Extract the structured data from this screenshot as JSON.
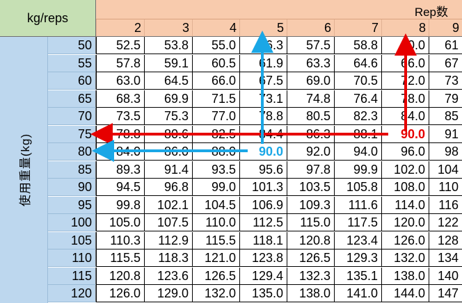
{
  "corner_label": "kg/reps",
  "header_title": "Rep数",
  "side_label": "使用重量(kg)",
  "columns": [
    "2",
    "3",
    "4",
    "5",
    "6",
    "7",
    "8",
    "9"
  ],
  "rows": [
    {
      "weight": "50",
      "values": [
        "52.5",
        "53.8",
        "55.0",
        "56.3",
        "57.5",
        "58.8",
        "60.0",
        "61"
      ]
    },
    {
      "weight": "55",
      "values": [
        "57.8",
        "59.1",
        "60.5",
        "61.9",
        "63.3",
        "64.6",
        "66.0",
        "67"
      ]
    },
    {
      "weight": "60",
      "values": [
        "63.0",
        "64.5",
        "66.0",
        "67.5",
        "69.0",
        "70.5",
        "72.0",
        "73"
      ]
    },
    {
      "weight": "65",
      "values": [
        "68.3",
        "69.9",
        "71.5",
        "73.1",
        "74.8",
        "76.4",
        "78.0",
        "79"
      ]
    },
    {
      "weight": "70",
      "values": [
        "73.5",
        "75.3",
        "77.0",
        "78.8",
        "80.5",
        "82.3",
        "84.0",
        "85"
      ]
    },
    {
      "weight": "75",
      "values": [
        "78.8",
        "80.6",
        "82.5",
        "84.4",
        "86.3",
        "88.1",
        "90.0",
        "91"
      ]
    },
    {
      "weight": "80",
      "values": [
        "84.0",
        "86.0",
        "88.0",
        "90.0",
        "92.0",
        "94.0",
        "96.0",
        "98"
      ]
    },
    {
      "weight": "85",
      "values": [
        "89.3",
        "91.4",
        "93.5",
        "95.6",
        "97.8",
        "99.9",
        "102.0",
        "104"
      ]
    },
    {
      "weight": "90",
      "values": [
        "94.5",
        "96.8",
        "99.0",
        "101.3",
        "103.5",
        "105.8",
        "108.0",
        "110"
      ]
    },
    {
      "weight": "95",
      "values": [
        "99.8",
        "102.1",
        "104.5",
        "106.9",
        "109.3",
        "111.6",
        "114.0",
        "116"
      ]
    },
    {
      "weight": "100",
      "values": [
        "105.0",
        "107.5",
        "110.0",
        "112.5",
        "115.0",
        "117.5",
        "120.0",
        "122"
      ]
    },
    {
      "weight": "105",
      "values": [
        "110.3",
        "112.9",
        "115.5",
        "118.1",
        "120.8",
        "123.4",
        "126.0",
        "128"
      ]
    },
    {
      "weight": "110",
      "values": [
        "115.5",
        "118.3",
        "121.0",
        "123.8",
        "126.5",
        "129.3",
        "132.0",
        "134"
      ]
    },
    {
      "weight": "115",
      "values": [
        "120.8",
        "123.6",
        "126.5",
        "129.4",
        "132.3",
        "135.1",
        "138.0",
        "140"
      ]
    },
    {
      "weight": "120",
      "values": [
        "126.0",
        "129.0",
        "132.0",
        "135.0",
        "138.0",
        "141.0",
        "144.0",
        "147"
      ]
    }
  ],
  "highlights": [
    {
      "row": 5,
      "col": 6,
      "color": "#e60000",
      "direction": "up-and-left"
    },
    {
      "row": 6,
      "col": 3,
      "color": "#1aa7e6",
      "direction": "up-and-left"
    }
  ],
  "colors": {
    "corner_bg": "#c6e0b4",
    "header_bg": "#f8cbad",
    "side_bg": "#bdd7ee",
    "arrow_red": "#e60000",
    "arrow_blue": "#1aa7e6"
  }
}
